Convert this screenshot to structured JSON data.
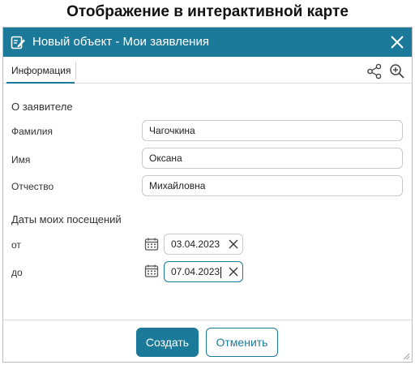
{
  "caption": "Отображение в интерактивной карте",
  "dialog": {
    "title": "Новый объект - Мои заявления",
    "title_icon": "edit-document-icon",
    "close_icon": "close-icon"
  },
  "tabs": [
    {
      "label": "Информация",
      "active": true
    }
  ],
  "toolbar": {
    "share_icon": "share-icon",
    "zoom_icon": "zoom-in-icon"
  },
  "applicant": {
    "section_title": "О заявителе",
    "fields": [
      {
        "label": "Фамилия",
        "value": "Чагочкина"
      },
      {
        "label": "Имя",
        "value": "Оксана"
      },
      {
        "label": "Отчество",
        "value": "Михайловна"
      }
    ]
  },
  "visits": {
    "section_title": "Даты моих посещений",
    "from_label": "от",
    "from_value": "03.04.2023",
    "to_label": "до",
    "to_value": "07.04.2023",
    "calendar_icon": "calendar-icon",
    "clear_icon": "clear-icon"
  },
  "buttons": {
    "create_label": "Создать",
    "cancel_label": "Отменить"
  },
  "colors": {
    "accent": "#1b7a9a",
    "border": "#c9c9c9"
  }
}
